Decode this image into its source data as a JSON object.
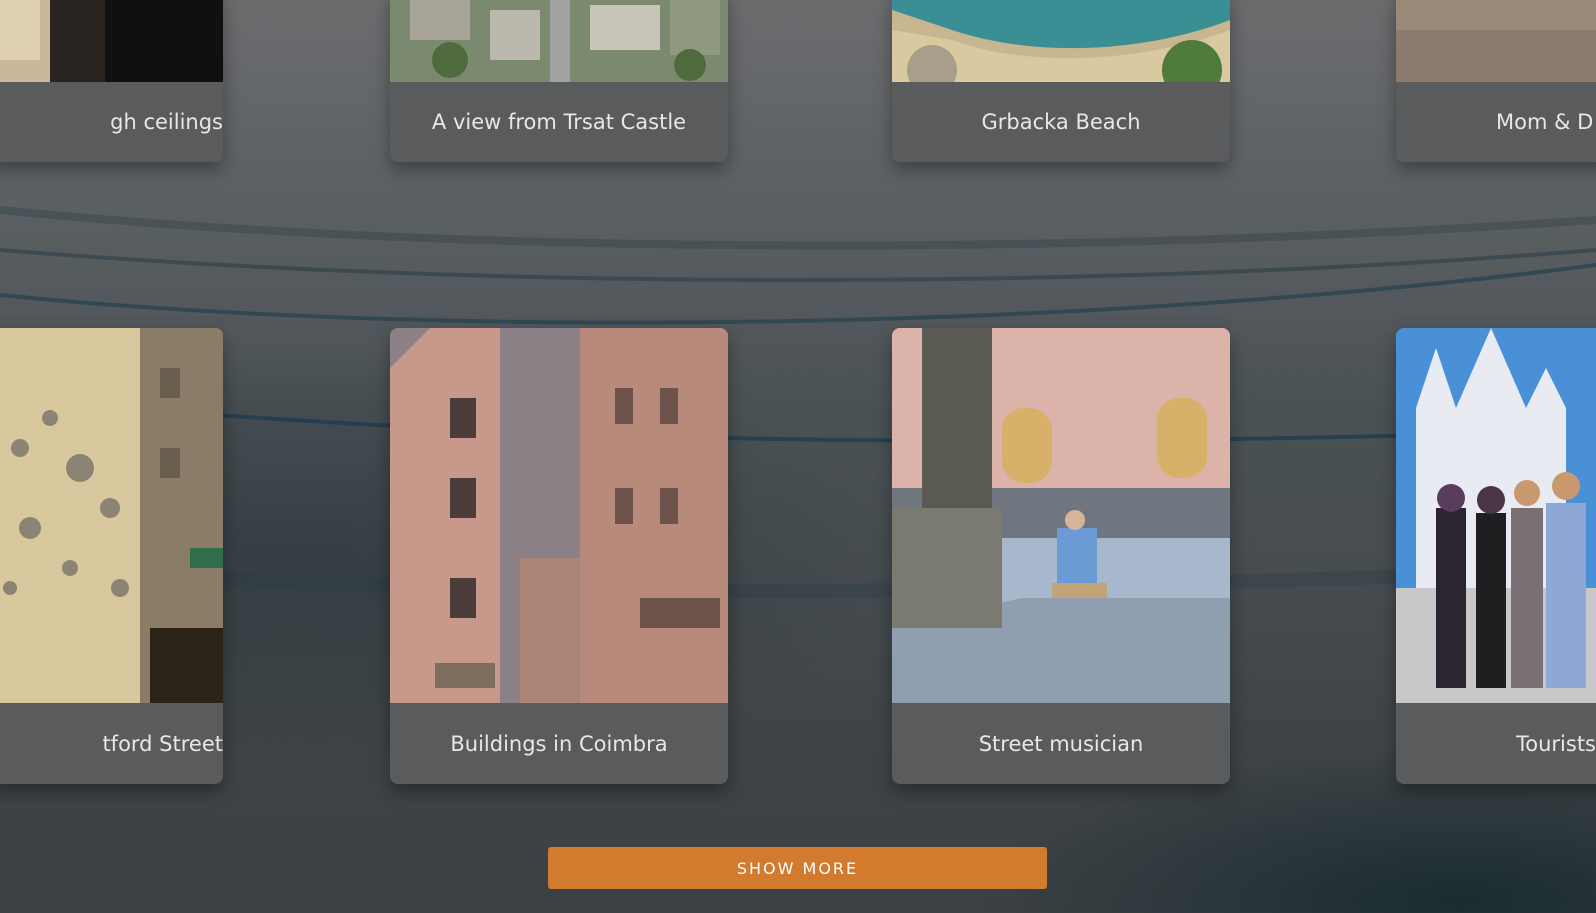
{
  "gallery": {
    "row1": [
      {
        "caption": "gh ceilings",
        "photo": "room-doorway-photo"
      },
      {
        "caption": "A view from Trsat Castle",
        "photo": "town-aerial-photo"
      },
      {
        "caption": "Grbacka Beach",
        "photo": "beach-coast-photo"
      },
      {
        "caption": "Mom & D",
        "photo": "pavement-photo"
      }
    ],
    "row2": [
      {
        "caption": "tford Street",
        "photo": "street-lanterns-photo"
      },
      {
        "caption": "Buildings in Coimbra",
        "photo": "coimbra-buildings-photo"
      },
      {
        "caption": "Street musician",
        "photo": "statue-musician-photo"
      },
      {
        "caption": "Tourists",
        "photo": "tourists-cathedral-photo"
      }
    ]
  },
  "actions": {
    "show_more": "SHOW MORE"
  },
  "colors": {
    "accent": "#d27a2d",
    "card": "#5a5b5d",
    "caption_text": "#e7e7e7"
  }
}
